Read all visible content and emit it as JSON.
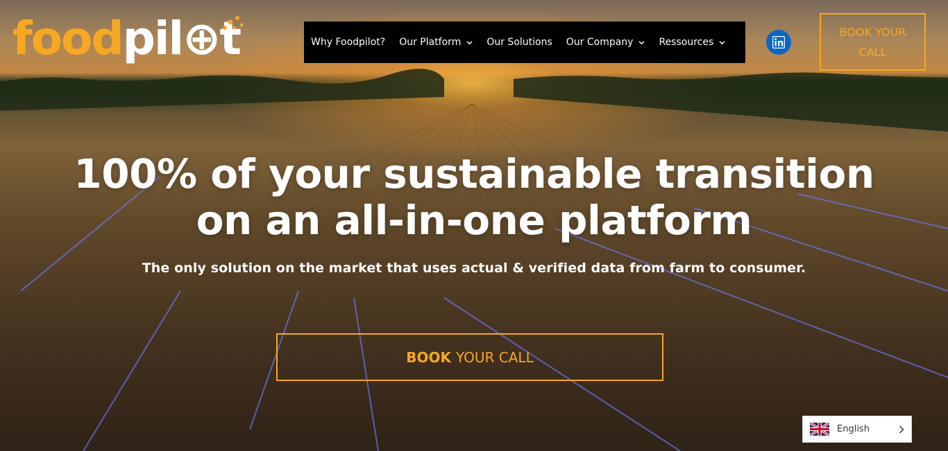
{
  "brand": {
    "logo_food": "food",
    "logo_pilot": "pil",
    "logo_end": "t",
    "accent_color": "#f7a823",
    "nav_bg": "#000000",
    "linkedin_color": "#0a66c2"
  },
  "nav": {
    "items": [
      {
        "label": "Why Foodpilot?",
        "has_dropdown": false
      },
      {
        "label": "Our Platform",
        "has_dropdown": true
      },
      {
        "label": "Our Solutions",
        "has_dropdown": false
      },
      {
        "label": "Our Company",
        "has_dropdown": true
      },
      {
        "label": "Ressources",
        "has_dropdown": true
      }
    ]
  },
  "header": {
    "cta_label": "BOOK YOUR CALL",
    "social_icon": "linkedin-icon"
  },
  "hero": {
    "headline_line1": "100% of your sustainable transition",
    "headline_line2": "on an all-in-one platform",
    "subline": "The only solution on the market that uses actual & verified data from farm to consumer.",
    "cta_bold": "BOOK",
    "cta_rest": "YOUR CALL"
  },
  "language": {
    "selected": "English",
    "flag_icon": "uk-flag-icon"
  }
}
